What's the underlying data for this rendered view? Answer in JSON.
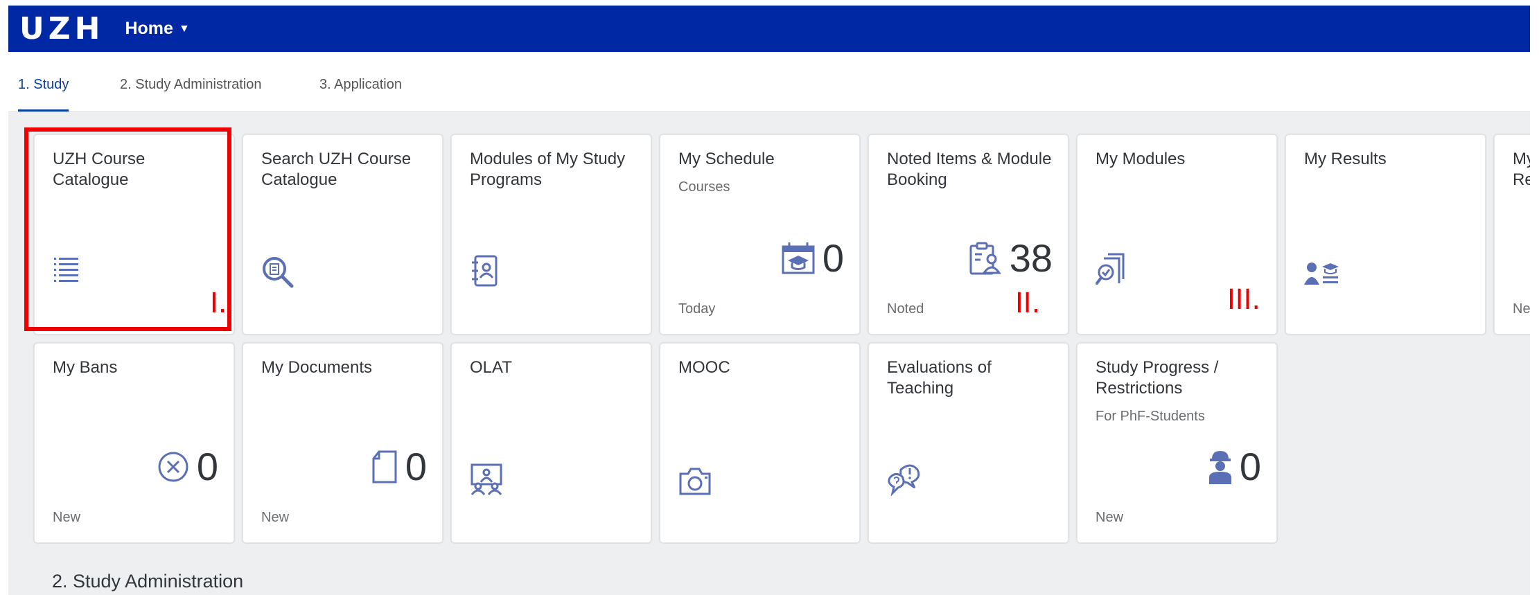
{
  "header": {
    "logo": "UZH",
    "home_label": "Home",
    "caret": "▼"
  },
  "tabs": [
    {
      "label": "1. Study",
      "active": true
    },
    {
      "label": "2. Study Administration",
      "active": false
    },
    {
      "label": "3. Application",
      "active": false
    }
  ],
  "tiles": {
    "course_catalogue": {
      "title": "UZH Course Catalogue",
      "icon": "list-icon"
    },
    "search_catalogue": {
      "title": "Search UZH Course Catalogue",
      "icon": "search-document-icon"
    },
    "modules_programs": {
      "title": "Modules of My Study Programs",
      "icon": "address-book-icon"
    },
    "schedule": {
      "title": "My Schedule",
      "subtitle": "Courses",
      "value": "0",
      "footer": "Today",
      "icon": "calendar-graduation-icon"
    },
    "noted_items": {
      "title": "Noted Items & Module Booking",
      "value": "38",
      "footer": "Noted",
      "icon": "clipboard-person-icon"
    },
    "my_modules": {
      "title": "My Modules",
      "icon": "document-search-icon"
    },
    "my_results": {
      "title": "My Results",
      "icon": "people-results-icon"
    },
    "partial": {
      "title": "My Re",
      "footer": "Ne"
    },
    "my_bans": {
      "title": "My Bans",
      "value": "0",
      "footer": "New",
      "icon": "circle-x-icon"
    },
    "my_documents": {
      "title": "My Documents",
      "value": "0",
      "footer": "New",
      "icon": "document-icon"
    },
    "olat": {
      "title": "OLAT",
      "icon": "group-presentation-icon"
    },
    "mooc": {
      "title": "MOOC",
      "icon": "camera-icon"
    },
    "evaluations": {
      "title": "Evaluations of Teaching",
      "icon": "feedback-icon"
    },
    "study_progress": {
      "title": "Study Progress / Restrictions",
      "subtitle": "For PhF-Students",
      "value": "0",
      "footer": "New",
      "icon": "worker-icon"
    }
  },
  "annotations": {
    "marker1": "I.",
    "marker2": "II.",
    "marker3": "III."
  },
  "section": {
    "title": "2. Study Administration"
  },
  "colors": {
    "header_bg": "#0028a5",
    "accent": "#0a3fa0",
    "icon": "#5b6fb5",
    "annotation": "#ee0000",
    "background": "#edeff0"
  }
}
